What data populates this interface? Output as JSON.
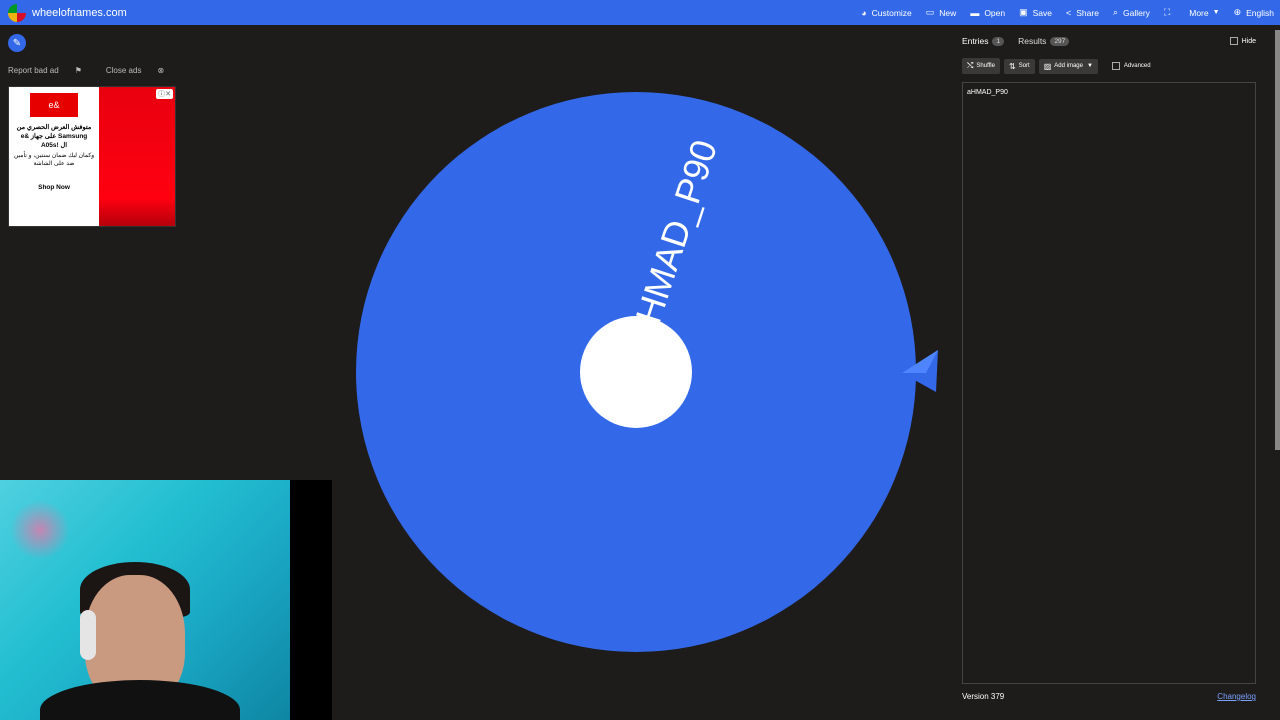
{
  "brand": {
    "name": "wheelofnames.com"
  },
  "nav": [
    {
      "icon": "palette-icon",
      "glyph": "◕",
      "label": "Customize"
    },
    {
      "icon": "file-icon",
      "glyph": "▭",
      "label": "New"
    },
    {
      "icon": "folder-icon",
      "glyph": "▬",
      "label": "Open"
    },
    {
      "icon": "save-icon",
      "glyph": "▣",
      "label": "Save"
    },
    {
      "icon": "share-icon",
      "glyph": "<",
      "label": "Share"
    },
    {
      "icon": "search-icon",
      "glyph": "⌕",
      "label": "Gallery"
    },
    {
      "icon": "fullscreen-icon",
      "glyph": "⛶",
      "label": ""
    },
    {
      "icon": "chevron-down-icon",
      "glyph": "",
      "label": "More"
    },
    {
      "icon": "globe-icon",
      "glyph": "⊕",
      "label": "English"
    }
  ],
  "ads": {
    "report_label": "Report bad ad",
    "close_label": "Close ads",
    "logo_text": "e&",
    "headline": "متوفش العرض الحصري من e& على جهاز Samsung A05s! ال",
    "subtext": "وكمان ليك ضمان سنتين، و تأمين ضد على الشاشة",
    "cta": "Shop Now"
  },
  "wheel": {
    "entry_label": "aHMAD_P90",
    "color": "#3369e8",
    "center_color": "#ffffff"
  },
  "panel": {
    "tabs": [
      {
        "label": "Entries",
        "badge": "1"
      },
      {
        "label": "Results",
        "badge": "297"
      }
    ],
    "hide_label": "Hide",
    "toolbar": {
      "shuffle_label": "Shuffle",
      "sort_label": "Sort",
      "add_image_label": "Add image",
      "advanced_label": "Advanced"
    },
    "entries": [
      "aHMAD_P90"
    ],
    "version": "Version 379",
    "changelog": "Changelog"
  }
}
